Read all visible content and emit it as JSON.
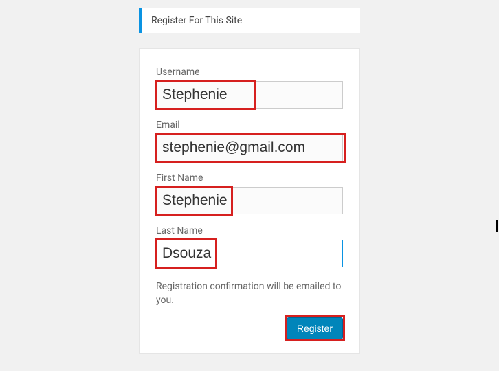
{
  "header": {
    "title": "Register For This Site"
  },
  "form": {
    "username": {
      "label": "Username",
      "value": "Stephenie"
    },
    "email": {
      "label": "Email",
      "value": "stephenie@gmail.com"
    },
    "first_name": {
      "label": "First Name",
      "value": "Stephenie"
    },
    "last_name": {
      "label": "Last Name",
      "value": "Dsouza"
    },
    "note": "Registration confirmation will be emailed to you.",
    "submit_label": "Register"
  }
}
